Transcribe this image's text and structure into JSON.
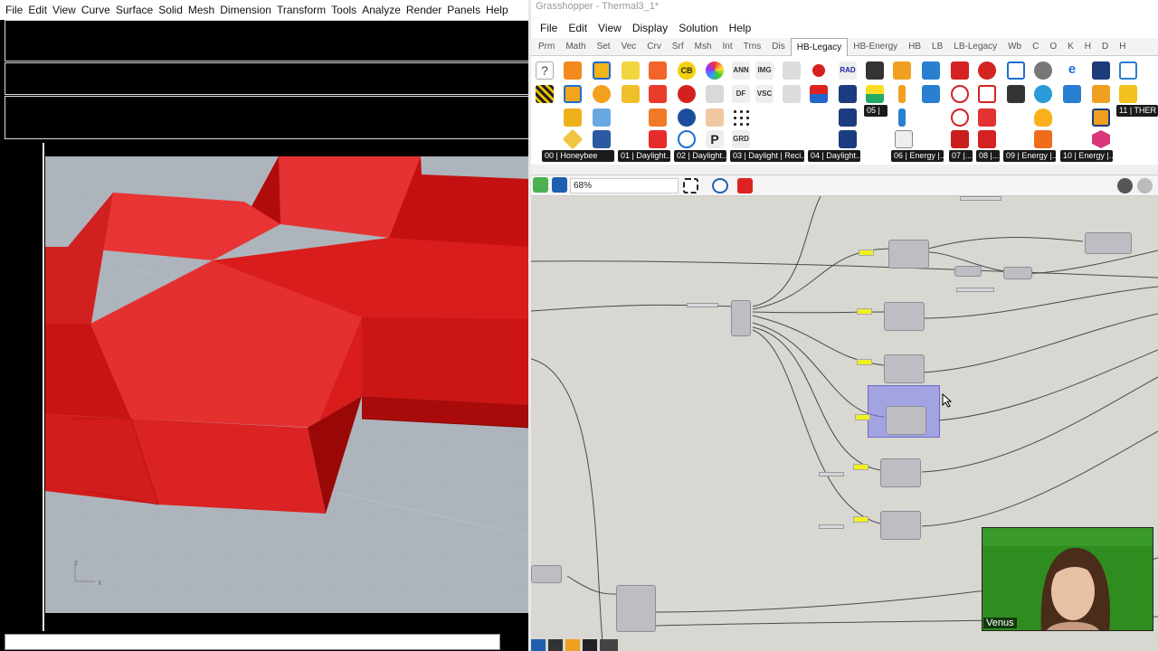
{
  "rhino": {
    "menu": [
      "File",
      "Edit",
      "View",
      "Curve",
      "Surface",
      "Solid",
      "Mesh",
      "Dimension",
      "Transform",
      "Tools",
      "Analyze",
      "Render",
      "Panels",
      "Help"
    ],
    "axis_z": "z",
    "axis_x": "x"
  },
  "grasshopper": {
    "title": "Grasshopper - Thermal3_1*",
    "menu": [
      "File",
      "Edit",
      "View",
      "Display",
      "Solution",
      "Help"
    ],
    "tabs": [
      "Prm",
      "Math",
      "Set",
      "Vec",
      "Crv",
      "Srf",
      "Msh",
      "Int",
      "Trns",
      "Dis",
      "HB-Legacy",
      "HB-Energy",
      "HB",
      "LB",
      "LB-Legacy",
      "Wb",
      "C",
      "O",
      "K",
      "H",
      "D",
      "H"
    ],
    "active_tab": "HB-Legacy",
    "group_labels": [
      "00 | Honeybee",
      "01 | Daylight...",
      "02 | Daylight...",
      "03 | Daylight | Reci...",
      "04 | Daylight...",
      "06 | Energy |...",
      "07 |...",
      "08 |...",
      "09 | Energy |...",
      "10 | Energy |..."
    ],
    "ribbon_text": {
      "cb": "CB",
      "ann": "ANN",
      "img": "IMG",
      "df": "DF",
      "vsc": "VSC",
      "rad": "RAD",
      "grd": "GRD",
      "p": "P",
      "n05": "05 |",
      "n11": "11 | THER"
    },
    "zoom": "68%"
  },
  "webcam": {
    "name": "Venus"
  }
}
